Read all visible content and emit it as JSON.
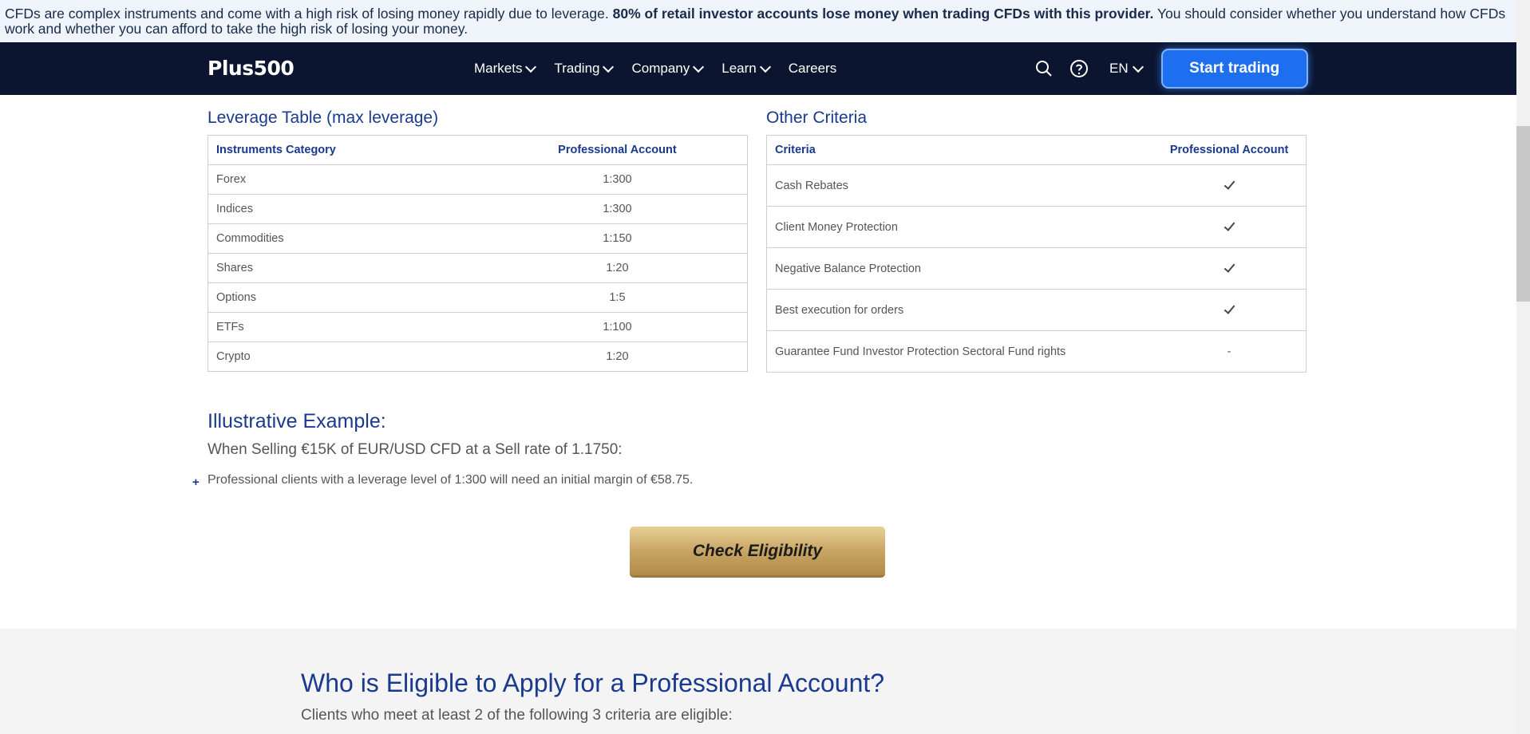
{
  "banner": {
    "part1": "CFDs are complex instruments and come with a high risk of losing money rapidly due to leverage. ",
    "bold": "80% of retail investor accounts lose money when trading CFDs with this provider.",
    "part2": " You should consider whether you understand how CFDs work and whether you can afford to take the high risk of losing your money."
  },
  "nav": {
    "logo": "Plus500",
    "items": [
      {
        "label": "Markets",
        "dropdown": true
      },
      {
        "label": "Trading",
        "dropdown": true
      },
      {
        "label": "Company",
        "dropdown": true
      },
      {
        "label": "Learn",
        "dropdown": true
      },
      {
        "label": "Careers",
        "dropdown": false
      }
    ],
    "language": "EN",
    "cta": "Start trading",
    "icons": [
      "search-icon",
      "help-icon"
    ]
  },
  "leverage_table": {
    "title": "Leverage Table (max leverage)",
    "headers": [
      "Instruments Category",
      "Professional Account"
    ],
    "rows": [
      [
        "Forex",
        "1:300"
      ],
      [
        "Indices",
        "1:300"
      ],
      [
        "Commodities",
        "1:150"
      ],
      [
        "Shares",
        "1:20"
      ],
      [
        "Options",
        "1:5"
      ],
      [
        "ETFs",
        "1:100"
      ],
      [
        "Crypto",
        "1:20"
      ]
    ]
  },
  "other_criteria": {
    "title": "Other Criteria",
    "headers": [
      "Criteria",
      "Professional Account"
    ],
    "rows": [
      [
        "Cash Rebates",
        "check"
      ],
      [
        "Client Money Protection",
        "check"
      ],
      [
        "Negative Balance Protection",
        "check"
      ],
      [
        "Best execution for orders",
        "check"
      ],
      [
        "Guarantee Fund Investor Protection Sectoral Fund rights",
        "-"
      ]
    ]
  },
  "example": {
    "title": "Illustrative Example:",
    "subtitle": "When Selling €15K of EUR/USD CFD at a Sell rate of 1.1750:",
    "bullet_mark": "+",
    "bullet": "Professional clients with a leverage level of 1:300 will need an initial margin of €58.75."
  },
  "check_button": "Check Eligibility",
  "eligibility": {
    "title": "Who is Eligible to Apply for a Professional Account?",
    "subtitle": "Clients who meet at least 2 of the following 3 criteria are eligible:"
  }
}
